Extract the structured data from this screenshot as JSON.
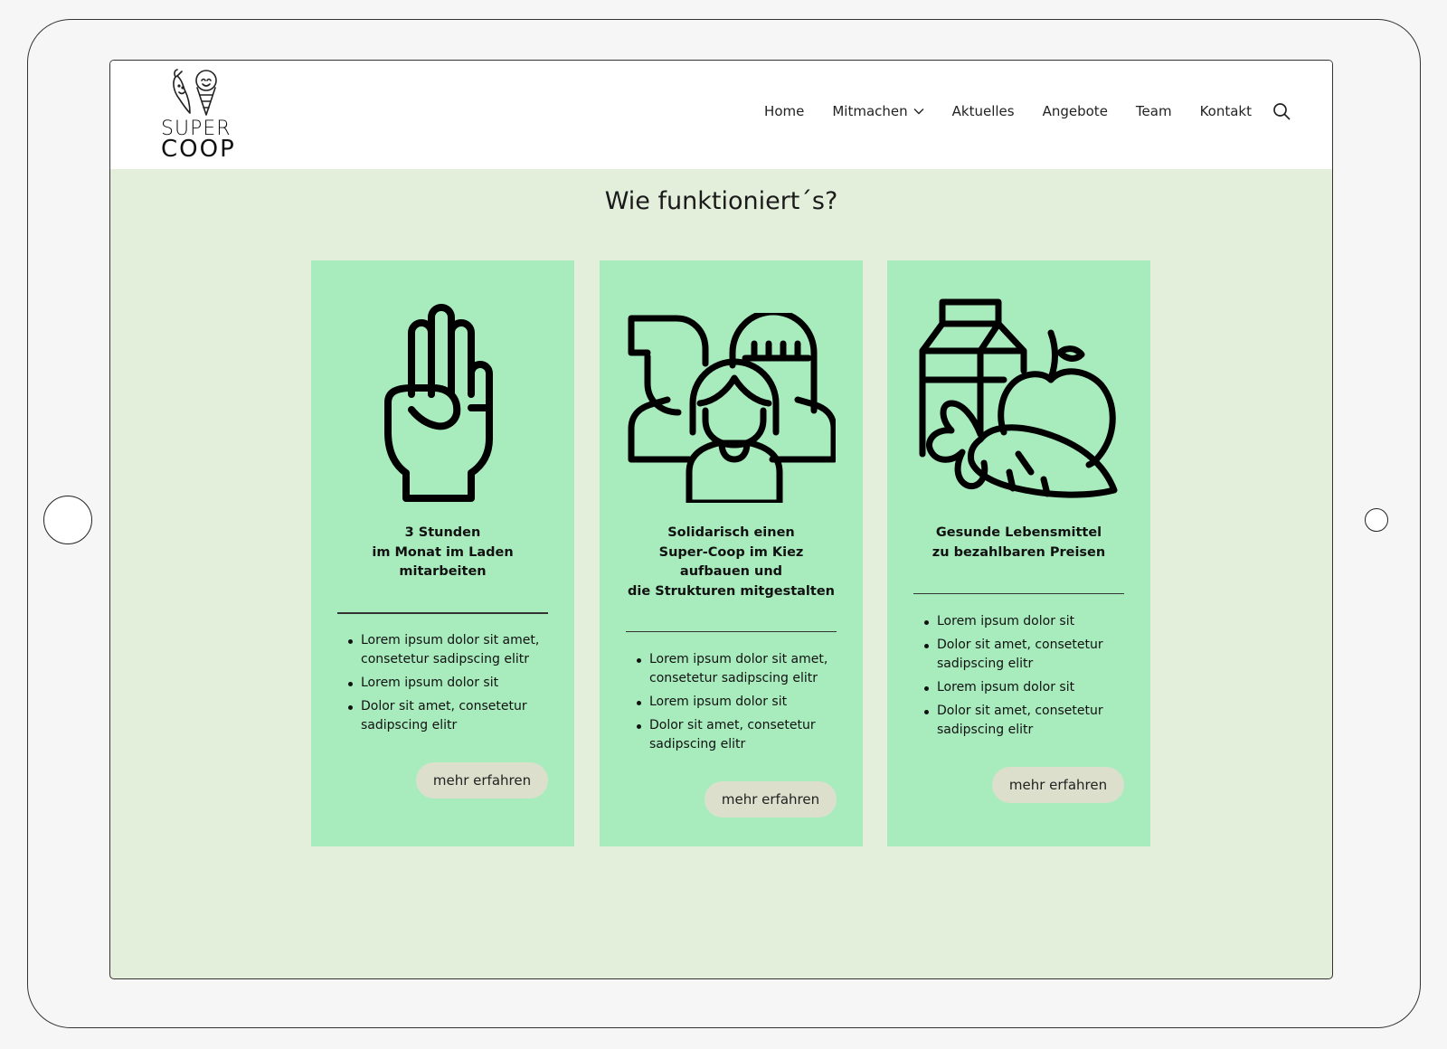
{
  "logo": {
    "line1": "SUPER",
    "line2": "COOP"
  },
  "nav": {
    "items": [
      {
        "label": "Home"
      },
      {
        "label": "Mitmachen"
      },
      {
        "label": "Aktuelles"
      },
      {
        "label": "Angebote"
      },
      {
        "label": "Team"
      },
      {
        "label": "Kontakt"
      }
    ],
    "icons": {
      "dropdown": "chevron-down-icon",
      "search": "search-icon"
    }
  },
  "section": {
    "title": "Wie funktioniert´s?"
  },
  "cards": [
    {
      "icon": "three-fingers-hand-icon",
      "title": "3 Stunden\nim Monat im Laden\nmitarbeiten",
      "bullets": [
        "Lorem ipsum dolor sit amet, consetetur sadipscing elitr",
        "Lorem ipsum dolor sit",
        "Dolor sit amet, consetetur sadipscing elitr"
      ],
      "button": "mehr erfahren"
    },
    {
      "icon": "community-people-icon",
      "title": "Solidarisch einen\nSuper-Coop im Kiez\naufbauen und\ndie Strukturen mitgestalten",
      "bullets": [
        "Lorem ipsum dolor sit amet, consetetur sadipscing elitr",
        "Lorem ipsum dolor sit",
        "Dolor sit amet, consetetur sadipscing elitr"
      ],
      "button": "mehr erfahren"
    },
    {
      "icon": "groceries-milk-apple-carrot-icon",
      "title": "Gesunde Lebensmittel\nzu bezahlbaren Preisen",
      "bullets": [
        "Lorem ipsum dolor sit",
        "Dolor sit amet, consetetur sadipscing elitr",
        "Lorem ipsum dolor sit",
        "Dolor sit amet, consetetur sadipscing elitr"
      ],
      "button": "mehr erfahren"
    }
  ],
  "colors": {
    "page_bg": "#e3eedb",
    "card_bg": "#a8ecbe",
    "button_bg": "#dcdfcc",
    "text": "#111111"
  }
}
